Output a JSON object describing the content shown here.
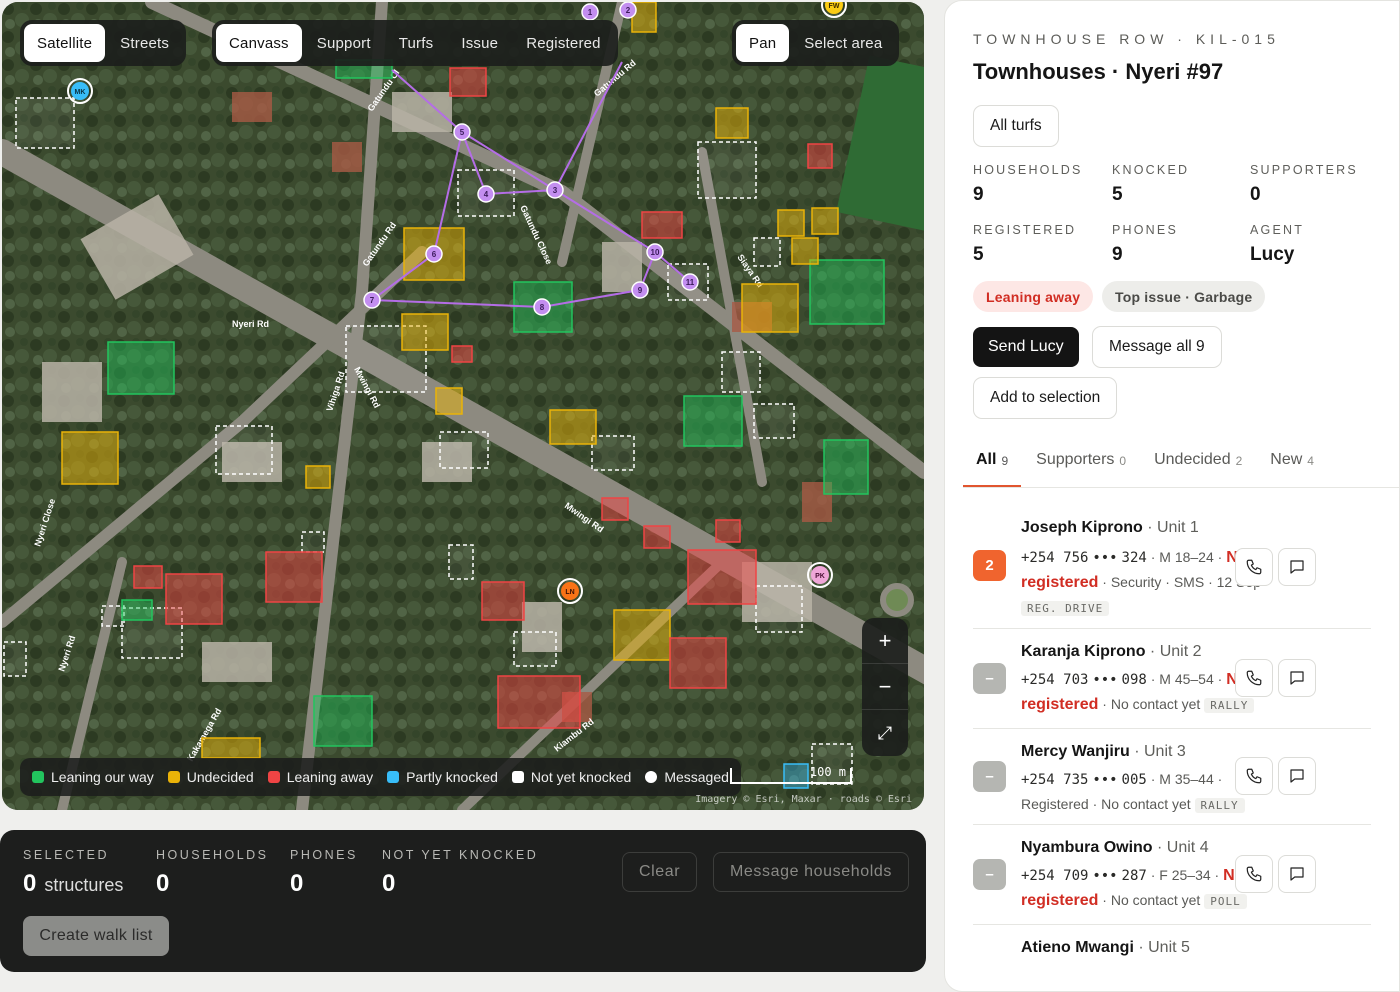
{
  "map": {
    "layers": [
      {
        "label": "Satellite",
        "active": true
      },
      {
        "label": "Streets",
        "active": false
      }
    ],
    "modes": [
      {
        "label": "Canvass",
        "active": true
      },
      {
        "label": "Support",
        "active": false
      },
      {
        "label": "Turfs",
        "active": false
      },
      {
        "label": "Issue",
        "active": false
      },
      {
        "label": "Registered",
        "active": false
      }
    ],
    "tools": [
      {
        "label": "Pan",
        "active": true
      },
      {
        "label": "Select area",
        "active": false
      }
    ],
    "zoom": {
      "in": "+",
      "out": "−",
      "fullscreen": "⤢"
    },
    "legend": [
      {
        "label": "Leaning our way",
        "color": "#22c55e"
      },
      {
        "label": "Undecided",
        "color": "#eab308"
      },
      {
        "label": "Leaning away",
        "color": "#ef4444"
      },
      {
        "label": "Partly knocked",
        "color": "#38bdf8"
      },
      {
        "label": "Not yet knocked",
        "color": "#ffffff"
      },
      {
        "label": "Messaged",
        "color": "#ffffff"
      }
    ],
    "scale": "100 m",
    "attribution": "Imagery © Esri, Maxar · roads © Esri",
    "roads": [
      "Gatundu Cl",
      "Gatundu Rd",
      "Gatundu Close",
      "Gatundu Rd",
      "Nyeri Rd",
      "Mwingi Rd",
      "Vihiga Rd",
      "Nyeri Close",
      "Nyeri Rd",
      "Mwingi Rd",
      "Kiambu Rd",
      "Kakamega Rd",
      "Siaya Rd"
    ],
    "agents": [
      "MK",
      "LN",
      "PK",
      "FW"
    ],
    "route_stops": [
      "1",
      "2",
      "3",
      "4",
      "5",
      "6",
      "7",
      "8",
      "9",
      "10",
      "11"
    ]
  },
  "selection": {
    "stats": [
      {
        "label": "SELECTED",
        "value": "0",
        "unit": "structures"
      },
      {
        "label": "HOUSEHOLDS",
        "value": "0",
        "unit": ""
      },
      {
        "label": "PHONES",
        "value": "0",
        "unit": ""
      },
      {
        "label": "NOT YET KNOCKED",
        "value": "0",
        "unit": ""
      }
    ],
    "clear_label": "Clear",
    "message_label": "Message households",
    "walk_label": "Create walk list"
  },
  "panel": {
    "eyebrow": "TOWNHOUSE ROW · KIL-015",
    "title": "Townhouses · Nyeri #97",
    "all_turfs_label": "All turfs",
    "stats": [
      {
        "label": "HOUSEHOLDS",
        "value": "9"
      },
      {
        "label": "KNOCKED",
        "value": "5"
      },
      {
        "label": "SUPPORTERS",
        "value": "0"
      },
      {
        "label": "REGISTERED",
        "value": "5"
      },
      {
        "label": "PHONES",
        "value": "9"
      },
      {
        "label": "AGENT",
        "value": "Lucy"
      }
    ],
    "pills": [
      {
        "label": "Leaning away",
        "bg": "#fde7e5",
        "fg": "#d12d23"
      },
      {
        "label": "Top issue · Garbage",
        "bg": "#ededea",
        "fg": "#4a4a47"
      }
    ],
    "send_label": "Send Lucy",
    "message_all_label": "Message all 9",
    "add_selection_label": "Add to selection",
    "tabs": [
      {
        "label": "All",
        "count": "9",
        "active": true
      },
      {
        "label": "Supporters",
        "count": "0",
        "active": false
      },
      {
        "label": "Undecided",
        "count": "2",
        "active": false
      },
      {
        "label": "New",
        "count": "4",
        "active": false
      }
    ],
    "households": [
      {
        "badge": "2",
        "badge_color": "#f0642e",
        "name": "Joseph Kiprono",
        "unit": "Unit 1",
        "phone_a": "+254 756",
        "phone_b": "324",
        "demo": "M 18–24",
        "status": "Not registered",
        "status_red": true,
        "detail": "Security · SMS · 12 Sep",
        "tag": "REG. DRIVE"
      },
      {
        "badge": "–",
        "badge_color": "#b5b6b2",
        "name": "Karanja Kiprono",
        "unit": "Unit 2",
        "phone_a": "+254 703",
        "phone_b": "098",
        "demo": "M 45–54",
        "status": "Not registered",
        "status_red": true,
        "detail": "No contact yet",
        "tag": "RALLY"
      },
      {
        "badge": "–",
        "badge_color": "#b5b6b2",
        "name": "Mercy Wanjiru",
        "unit": "Unit 3",
        "phone_a": "+254 735",
        "phone_b": "005",
        "demo": "M 35–44",
        "status": "Registered",
        "status_red": false,
        "detail": "No contact yet",
        "tag": "RALLY"
      },
      {
        "badge": "–",
        "badge_color": "#b5b6b2",
        "name": "Nyambura Owino",
        "unit": "Unit 4",
        "phone_a": "+254 709",
        "phone_b": "287",
        "demo": "F 25–34",
        "status": "Not registered",
        "status_red": true,
        "detail": "No contact yet",
        "tag": "POLL"
      },
      {
        "badge": "",
        "badge_color": "",
        "name": "Atieno Mwangi",
        "unit": "Unit 5",
        "phone_a": "",
        "phone_b": "",
        "demo": "",
        "status": "",
        "status_red": false,
        "detail": "",
        "tag": ""
      }
    ]
  }
}
